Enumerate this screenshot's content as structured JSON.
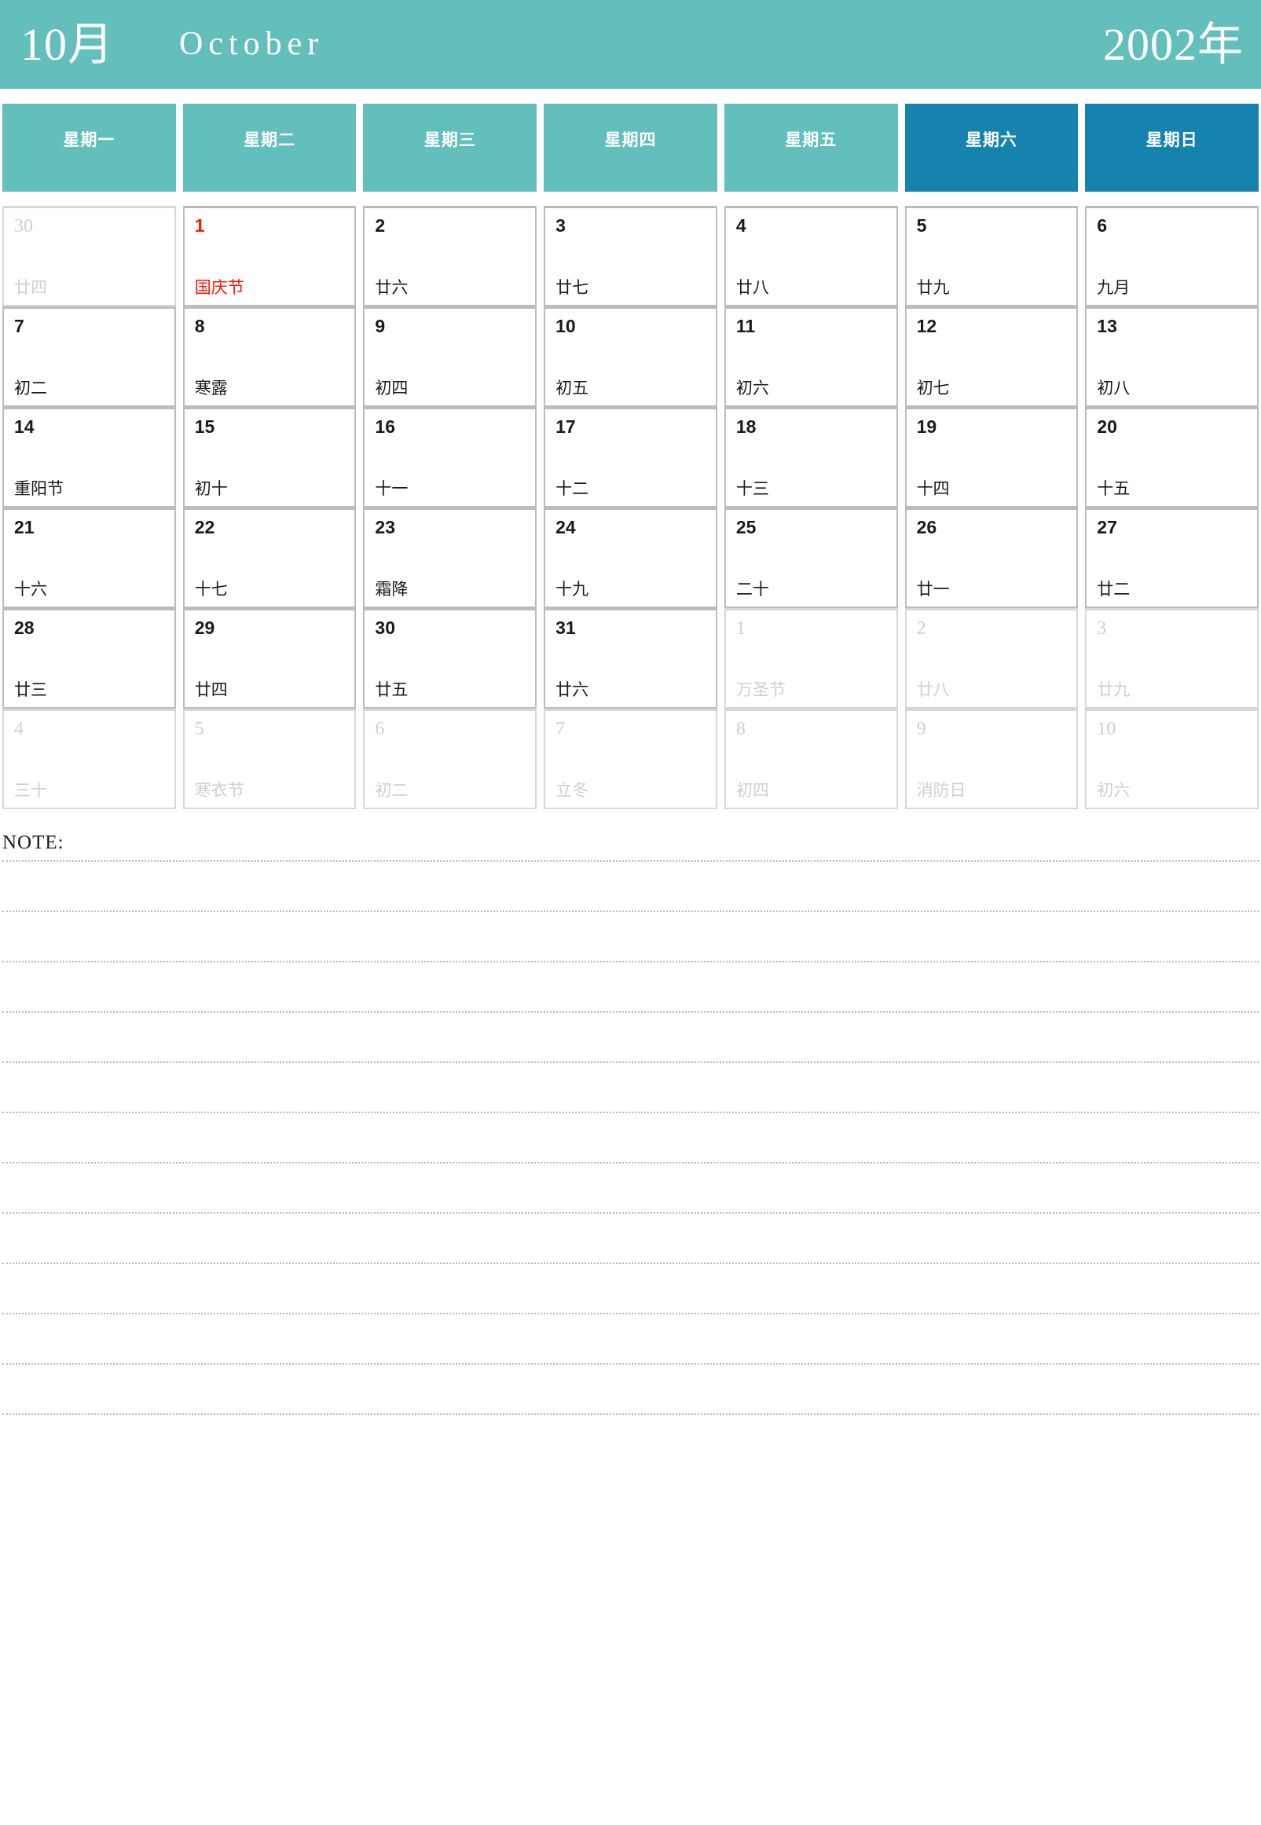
{
  "header": {
    "month_cn": "10月",
    "month_en": "October",
    "year": "2002年",
    "banner_color": "#62bfbc"
  },
  "weekdays": [
    {
      "label": "星期一",
      "type": "weekday",
      "color": "#62bfbc"
    },
    {
      "label": "星期二",
      "type": "weekday",
      "color": "#62bfbc"
    },
    {
      "label": "星期三",
      "type": "weekday",
      "color": "#62bfbc"
    },
    {
      "label": "星期四",
      "type": "weekday",
      "color": "#62bfbc"
    },
    {
      "label": "星期五",
      "type": "weekday",
      "color": "#62bfbc"
    },
    {
      "label": "星期六",
      "type": "weekend",
      "color": "#1683ae"
    },
    {
      "label": "星期日",
      "type": "weekend",
      "color": "#1683ae"
    }
  ],
  "weeks": [
    [
      {
        "day": "30",
        "lunar": "廿四",
        "muted": true,
        "holiday": false,
        "festival": false
      },
      {
        "day": "1",
        "lunar": "国庆节",
        "muted": false,
        "holiday": true,
        "festival": true
      },
      {
        "day": "2",
        "lunar": "廿六",
        "muted": false,
        "holiday": false,
        "festival": false
      },
      {
        "day": "3",
        "lunar": "廿七",
        "muted": false,
        "holiday": false,
        "festival": false
      },
      {
        "day": "4",
        "lunar": "廿八",
        "muted": false,
        "holiday": false,
        "festival": false
      },
      {
        "day": "5",
        "lunar": "廿九",
        "muted": false,
        "holiday": false,
        "festival": false
      },
      {
        "day": "6",
        "lunar": "九月",
        "muted": false,
        "holiday": false,
        "festival": false
      }
    ],
    [
      {
        "day": "7",
        "lunar": "初二",
        "muted": false,
        "holiday": false,
        "festival": false
      },
      {
        "day": "8",
        "lunar": "寒露",
        "muted": false,
        "holiday": false,
        "festival": false
      },
      {
        "day": "9",
        "lunar": "初四",
        "muted": false,
        "holiday": false,
        "festival": false
      },
      {
        "day": "10",
        "lunar": "初五",
        "muted": false,
        "holiday": false,
        "festival": false
      },
      {
        "day": "11",
        "lunar": "初六",
        "muted": false,
        "holiday": false,
        "festival": false
      },
      {
        "day": "12",
        "lunar": "初七",
        "muted": false,
        "holiday": false,
        "festival": false
      },
      {
        "day": "13",
        "lunar": "初八",
        "muted": false,
        "holiday": false,
        "festival": false
      }
    ],
    [
      {
        "day": "14",
        "lunar": "重阳节",
        "muted": false,
        "holiday": false,
        "festival": false
      },
      {
        "day": "15",
        "lunar": "初十",
        "muted": false,
        "holiday": false,
        "festival": false
      },
      {
        "day": "16",
        "lunar": "十一",
        "muted": false,
        "holiday": false,
        "festival": false
      },
      {
        "day": "17",
        "lunar": "十二",
        "muted": false,
        "holiday": false,
        "festival": false
      },
      {
        "day": "18",
        "lunar": "十三",
        "muted": false,
        "holiday": false,
        "festival": false
      },
      {
        "day": "19",
        "lunar": "十四",
        "muted": false,
        "holiday": false,
        "festival": false
      },
      {
        "day": "20",
        "lunar": "十五",
        "muted": false,
        "holiday": false,
        "festival": false
      }
    ],
    [
      {
        "day": "21",
        "lunar": "十六",
        "muted": false,
        "holiday": false,
        "festival": false
      },
      {
        "day": "22",
        "lunar": "十七",
        "muted": false,
        "holiday": false,
        "festival": false
      },
      {
        "day": "23",
        "lunar": "霜降",
        "muted": false,
        "holiday": false,
        "festival": false
      },
      {
        "day": "24",
        "lunar": "十九",
        "muted": false,
        "holiday": false,
        "festival": false
      },
      {
        "day": "25",
        "lunar": "二十",
        "muted": false,
        "holiday": false,
        "festival": false
      },
      {
        "day": "26",
        "lunar": "廿一",
        "muted": false,
        "holiday": false,
        "festival": false
      },
      {
        "day": "27",
        "lunar": "廿二",
        "muted": false,
        "holiday": false,
        "festival": false
      }
    ],
    [
      {
        "day": "28",
        "lunar": "廿三",
        "muted": false,
        "holiday": false,
        "festival": false
      },
      {
        "day": "29",
        "lunar": "廿四",
        "muted": false,
        "holiday": false,
        "festival": false
      },
      {
        "day": "30",
        "lunar": "廿五",
        "muted": false,
        "holiday": false,
        "festival": false
      },
      {
        "day": "31",
        "lunar": "廿六",
        "muted": false,
        "holiday": false,
        "festival": false
      },
      {
        "day": "1",
        "lunar": "万圣节",
        "muted": true,
        "holiday": false,
        "festival": true
      },
      {
        "day": "2",
        "lunar": "廿八",
        "muted": true,
        "holiday": false,
        "festival": false
      },
      {
        "day": "3",
        "lunar": "廿九",
        "muted": true,
        "holiday": false,
        "festival": false
      }
    ],
    [
      {
        "day": "4",
        "lunar": "三十",
        "muted": true,
        "holiday": false,
        "festival": false
      },
      {
        "day": "5",
        "lunar": "寒衣节",
        "muted": true,
        "holiday": false,
        "festival": true
      },
      {
        "day": "6",
        "lunar": "初二",
        "muted": true,
        "holiday": false,
        "festival": false
      },
      {
        "day": "7",
        "lunar": "立冬",
        "muted": true,
        "holiday": false,
        "festival": false
      },
      {
        "day": "8",
        "lunar": "初四",
        "muted": true,
        "holiday": false,
        "festival": false
      },
      {
        "day": "9",
        "lunar": "消防日",
        "muted": true,
        "holiday": false,
        "festival": true
      },
      {
        "day": "10",
        "lunar": "初六",
        "muted": true,
        "holiday": false,
        "festival": false
      }
    ]
  ],
  "note": {
    "label": "NOTE:",
    "line_count": 12
  }
}
